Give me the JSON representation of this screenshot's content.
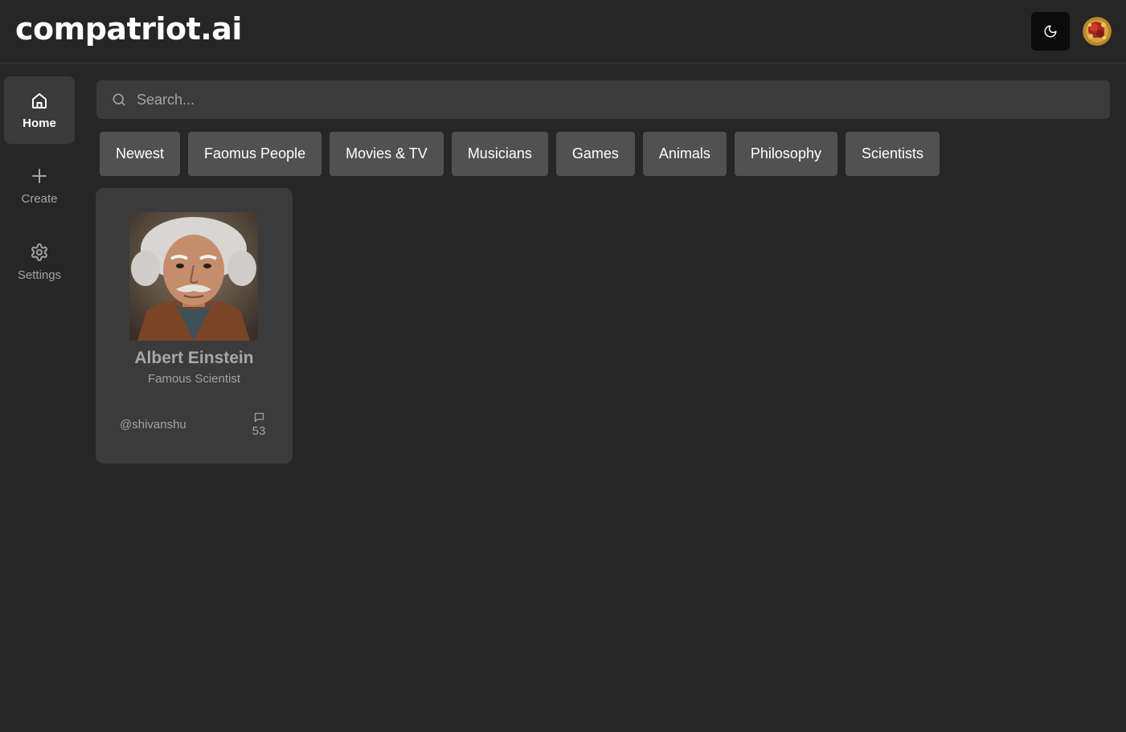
{
  "header": {
    "logo": "compatriot.ai",
    "theme_toggle_icon": "moon-icon",
    "avatar_icon": "user-avatar"
  },
  "sidebar": {
    "items": [
      {
        "label": "Home",
        "icon": "home-icon",
        "active": true
      },
      {
        "label": "Create",
        "icon": "plus-icon",
        "active": false
      },
      {
        "label": "Settings",
        "icon": "gear-icon",
        "active": false
      }
    ]
  },
  "search": {
    "placeholder": "Search...",
    "icon": "search-icon"
  },
  "categories": [
    "Newest",
    "Faomus People",
    "Movies & TV",
    "Musicians",
    "Games",
    "Animals",
    "Philosophy",
    "Scientists"
  ],
  "companions": [
    {
      "name": "Albert Einstein",
      "description": "Famous Scientist",
      "creator": "@shivanshu",
      "message_count": "53",
      "message_icon": "chat-bubble-icon"
    }
  ]
}
